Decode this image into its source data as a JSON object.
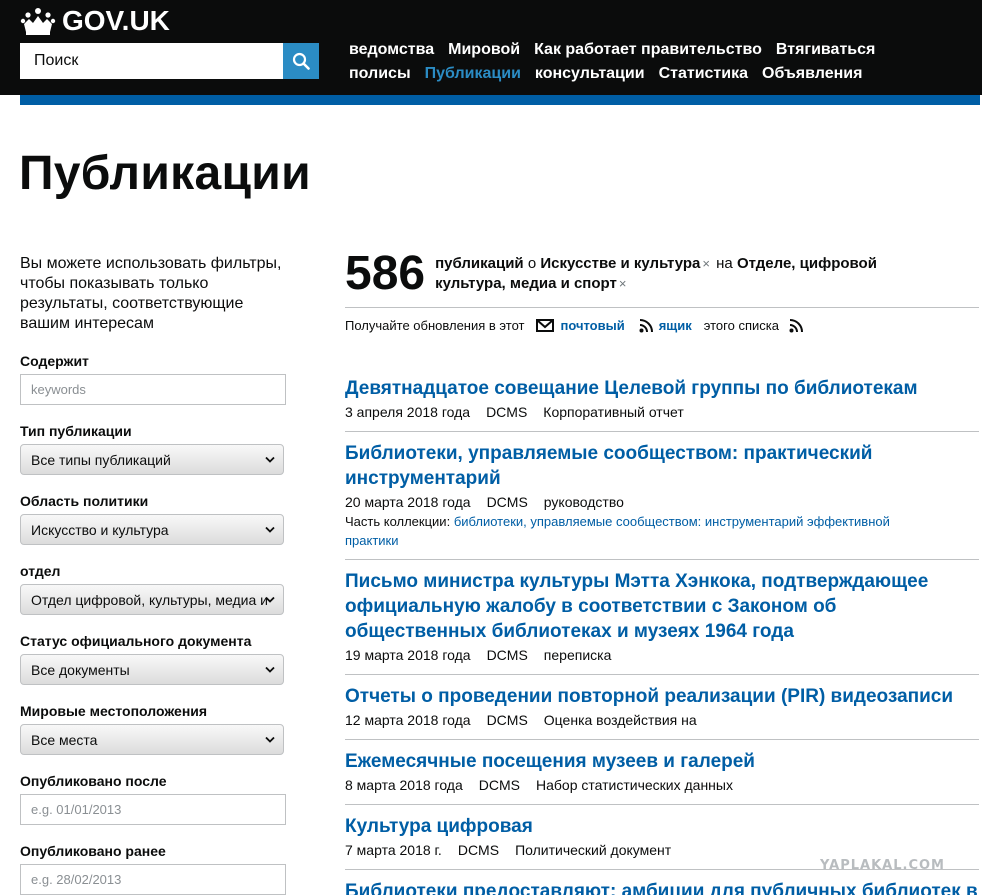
{
  "header": {
    "logo_text": "GOV.UK",
    "search_placeholder": "Поиск",
    "nav_row1": [
      "ведомства",
      "Мировой",
      "Как работает правительство",
      "Втягиваться"
    ],
    "nav_row2": [
      "полисы",
      "Публикации",
      "консультации",
      "Статистика",
      "Объявления"
    ],
    "active_item": "Публикации",
    "accent": "#2b8cc4"
  },
  "page_title": "Публикации",
  "sidebar": {
    "intro": "Вы можете использовать фильтры, чтобы показывать только результаты, соответствующие вашим интересам",
    "contains_label": "Содержит",
    "contains_placeholder": "keywords",
    "type_label": "Тип публикации",
    "type_value": "Все типы публикаций",
    "policy_label": "Область политики",
    "policy_value": "Искусство и культура",
    "dept_label": "отдел",
    "dept_value": "Отдел цифровой, культуры, медиа и",
    "status_label": "Статус официального документа",
    "status_value": "Все документы",
    "world_label": "Мировые местоположения",
    "world_value": "Все места",
    "after_label": "Опубликовано после",
    "after_placeholder": "e.g. 01/01/2013",
    "before_label": "Опубликовано ранее",
    "before_placeholder": "e.g. 28/02/2013"
  },
  "summary": {
    "count": "586",
    "word": "публикаций",
    "about": "о",
    "topic": "Искусстве и культура",
    "in": "на",
    "org": "Отделе, цифровой культура, медиа и спорт"
  },
  "subscribe": {
    "prefix": "Получайте обновления в этот",
    "email": "почтовый",
    "feed": "ящик",
    "suffix": "этого списка"
  },
  "results": [
    {
      "title": "Девятнадцатое совещание Целевой группы по библиотекам",
      "date": "3 апреля 2018 года",
      "org": "DCMS",
      "type": "Корпоративный отчет"
    },
    {
      "title": "Библиотеки, управляемые сообществом: практический инструментарий",
      "date": "20 марта 2018 года",
      "org": "DCMS",
      "type": "руководство",
      "collection_prefix": "Часть коллекции:",
      "collection": "библиотеки, управляемые сообществом: инструментарий эффективной практики"
    },
    {
      "title": "Письмо министра культуры Мэтта Хэнкока, подтверждающее официальную жалобу в соответствии с Законом об общественных библиотеках и музеях 1964 года",
      "date": "19 марта 2018 года",
      "org": "DCMS",
      "type": "переписка"
    },
    {
      "title": "Отчеты о проведении повторной реализации (PIR) видеозаписи",
      "date": "12 марта 2018 года",
      "org": "DCMS",
      "type": "Оценка воздействия на"
    },
    {
      "title": "Ежемесячные посещения музеев и галерей",
      "date": "8 марта 2018 года",
      "org": "DCMS",
      "type": "Набор статистических данных"
    },
    {
      "title": "Культура цифровая",
      "date": "7 марта 2018 г.",
      "org": "DCMS",
      "type": "Политический документ"
    },
    {
      "title": "Библиотеки предоставляют: амбиции для публичных библиотек в"
    }
  ],
  "watermark": "YAPLAKAL.COM"
}
